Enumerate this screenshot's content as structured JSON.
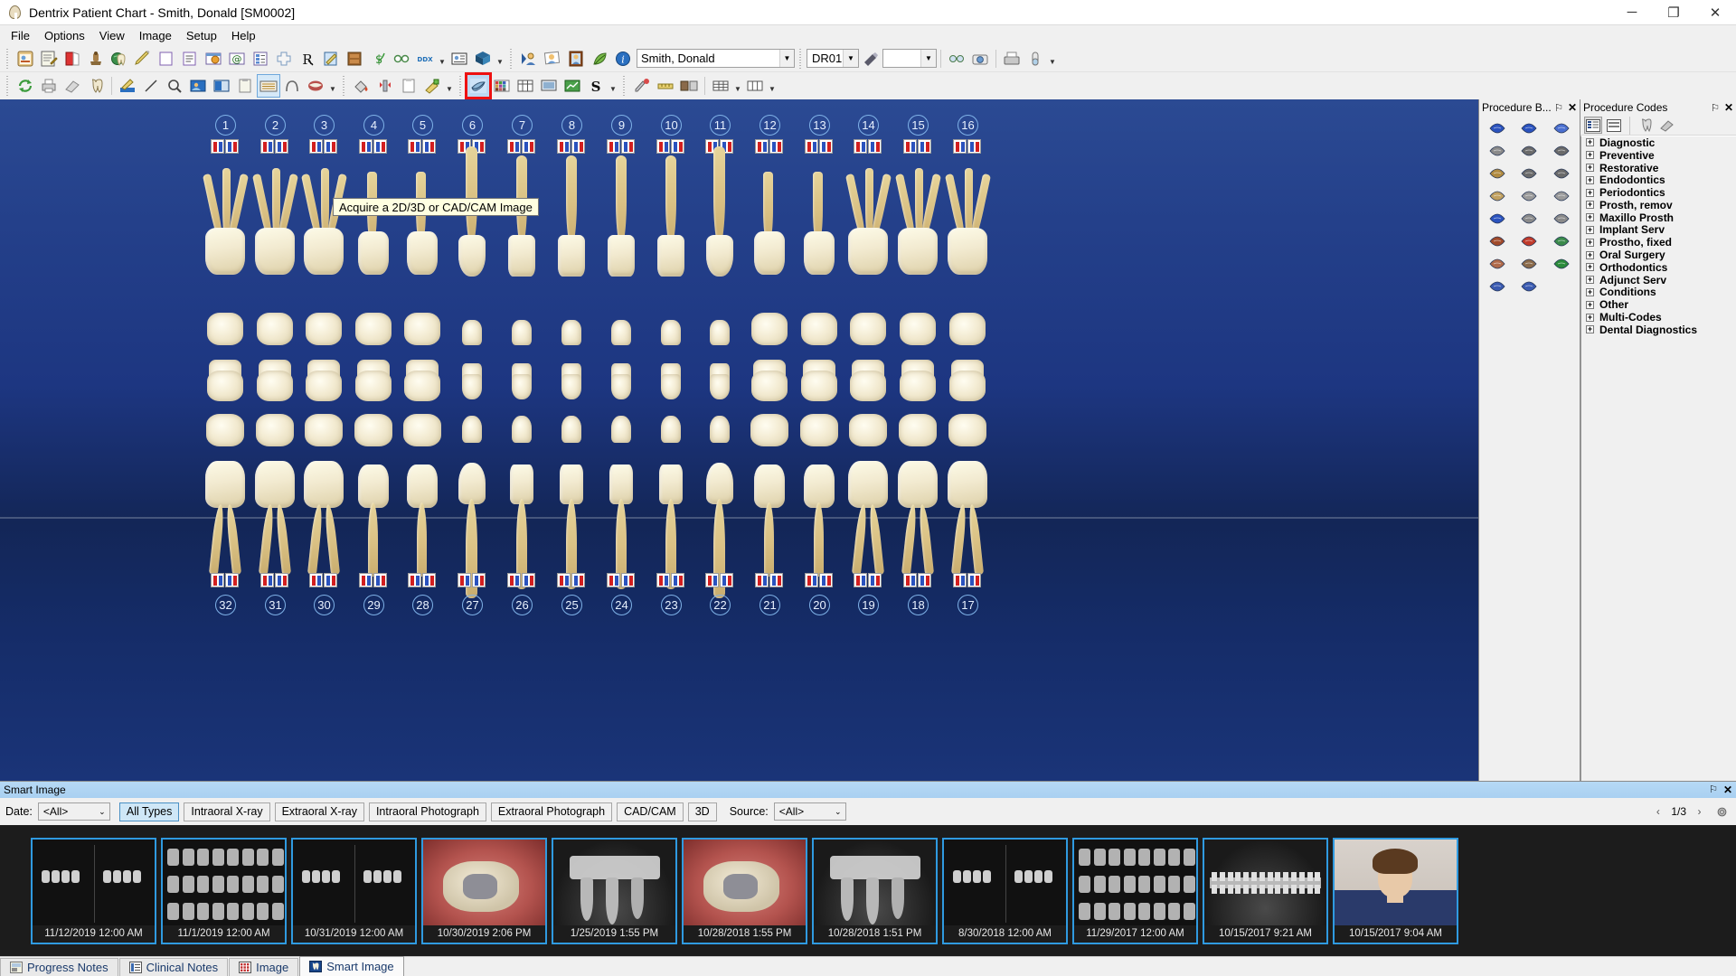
{
  "window": {
    "title": "Dentrix Patient Chart - Smith, Donald [SM0002]",
    "app_icon": "tooth-icon",
    "minimize": "─",
    "maximize": "❐",
    "close": "✕"
  },
  "menu": {
    "items": [
      {
        "label": "File"
      },
      {
        "label": "Options"
      },
      {
        "label": "View"
      },
      {
        "label": "Image"
      },
      {
        "label": "Setup"
      },
      {
        "label": "Help"
      }
    ]
  },
  "toolbar_top": {
    "buttons": [
      {
        "name": "patient-clipboard-icon"
      },
      {
        "name": "edit-notes-icon"
      },
      {
        "name": "ledger-book-icon"
      },
      {
        "name": "appointment-chair-icon"
      },
      {
        "name": "perio-globe-tooth-icon"
      },
      {
        "name": "treatment-planner-pencil-icon"
      },
      {
        "name": "blank-document-icon"
      },
      {
        "name": "document-lines-icon"
      },
      {
        "name": "office-journal-icon"
      },
      {
        "name": "email-at-icon"
      },
      {
        "name": "questionnaire-icon"
      },
      {
        "name": "medical-cross-icon"
      },
      {
        "name": "prescriptions-rx-icon"
      },
      {
        "name": "clinical-notes-icon"
      },
      {
        "name": "document-center-icon"
      },
      {
        "name": "treatment-money-icon"
      },
      {
        "name": "patient-referral-icon"
      },
      {
        "name": "ddx-icon",
        "label": "DDX"
      },
      {
        "name": "patient-card-icon"
      },
      {
        "name": "dentrix-cube-icon"
      }
    ],
    "buttons_right": [
      {
        "name": "family-file-icon"
      },
      {
        "name": "patient-picture-icon"
      },
      {
        "name": "patient-frame-icon"
      },
      {
        "name": "smart-image-leaf-icon"
      },
      {
        "name": "info-icon"
      }
    ],
    "patient_field": {
      "value": "Smith, Donald",
      "icon": "patient-avatar-icon"
    },
    "provider_combo": {
      "value": "DR01"
    },
    "ortho-icon": {
      "name": "ortho-brush-icon"
    },
    "blank_combo": {
      "value": ""
    },
    "trailing": [
      {
        "name": "glasses-icon"
      },
      {
        "name": "camera-icon"
      },
      {
        "name": "scanner-icon"
      },
      {
        "name": "pill-icon"
      }
    ]
  },
  "toolbar_second": {
    "buttons": [
      {
        "name": "refresh-green-arrows-icon"
      },
      {
        "name": "print-icon"
      },
      {
        "name": "eraser-icon"
      },
      {
        "name": "tooth-chart-icon"
      },
      {
        "name": "pencil-draw-icon"
      },
      {
        "name": "line-tool-icon"
      },
      {
        "name": "magnifier-icon"
      },
      {
        "name": "picture-blue-icon"
      },
      {
        "name": "picture-panel-icon"
      },
      {
        "name": "clipboard-small-icon"
      },
      {
        "name": "keyboard-icon"
      },
      {
        "name": "arch-icon"
      },
      {
        "name": "mouth-icon"
      }
    ],
    "group2": [
      {
        "name": "paint-bucket-icon"
      },
      {
        "name": "implant-icon"
      },
      {
        "name": "clipboard-white-icon"
      },
      {
        "name": "palette-icon"
      }
    ],
    "group3": [
      {
        "name": "acquire-image-icon",
        "highlighted": true
      },
      {
        "name": "color-grid-icon"
      },
      {
        "name": "template-icon"
      },
      {
        "name": "monitor-icon"
      },
      {
        "name": "green-chart-icon"
      },
      {
        "name": "smart-s-icon",
        "label": "S"
      }
    ],
    "group4": [
      {
        "name": "eyedropper-icon"
      },
      {
        "name": "measure-icon"
      },
      {
        "name": "compare-images-icon"
      },
      {
        "name": "grid-layout-icon"
      },
      {
        "name": "layout-columns-icon"
      }
    ]
  },
  "tooltip": {
    "text": "Acquire a 2D/3D or CAD/CAM Image"
  },
  "chart": {
    "upper_tooth_numbers": [
      "1",
      "2",
      "3",
      "4",
      "5",
      "6",
      "7",
      "8",
      "9",
      "10",
      "11",
      "12",
      "13",
      "14",
      "15",
      "16"
    ],
    "lower_tooth_numbers": [
      "32",
      "31",
      "30",
      "29",
      "28",
      "27",
      "26",
      "25",
      "24",
      "23",
      "22",
      "21",
      "20",
      "19",
      "18",
      "17"
    ]
  },
  "procedure_buttons_pane": {
    "title": "Procedure B...",
    "pin": "⚐",
    "close": "✕",
    "icons": [
      "amalgam-o-icon",
      "amalgam-mod-icon",
      "composite-hatch-icon",
      "post-core-icon",
      "crown-120-icon",
      "crown-140-icon",
      "tooth-hatch-icon",
      "crown-160-icon",
      "crown-160b-icon",
      "crown-gold-icon",
      "bridge-a-icon",
      "bridge-b-icon",
      "surface-s-icon",
      "inlay-icon",
      "onlay-icon",
      "extraction-icon",
      "endo-er-icon",
      "perio-icon",
      "denture-icon",
      "partial-icon",
      "watch-w-icon",
      "sealant-icon",
      "sealant-b-icon"
    ]
  },
  "procedure_codes_pane": {
    "title": "Procedure Codes",
    "pin": "⚐",
    "close": "✕",
    "toolbar": [
      {
        "name": "list-detail-view-icon",
        "active": true
      },
      {
        "name": "list-compact-view-icon",
        "active": false
      },
      {
        "name": "tooth-filter-icon",
        "active": false
      },
      {
        "name": "eraser-filter-icon",
        "active": false
      }
    ],
    "categories": [
      "Diagnostic",
      "Preventive",
      "Restorative",
      "Endodontics",
      "Periodontics",
      "Prosth, remov",
      "Maxillo Prosth",
      "Implant Serv",
      "Prostho, fixed",
      "Oral Surgery",
      "Orthodontics",
      "Adjunct Serv",
      "Conditions",
      "Other",
      "Multi-Codes",
      "Dental Diagnostics"
    ],
    "expand_glyph": "+"
  },
  "smart_image": {
    "panel_title": "Smart Image",
    "pin": "⚐",
    "close": "✕",
    "date_label": "Date:",
    "date_value": "<All>",
    "source_label": "Source:",
    "source_value": "<All>",
    "type_filters": [
      {
        "label": "All Types",
        "selected": true
      },
      {
        "label": "Intraoral X-ray",
        "selected": false
      },
      {
        "label": "Extraoral X-ray",
        "selected": false
      },
      {
        "label": "Intraoral Photograph",
        "selected": false
      },
      {
        "label": "Extraoral Photograph",
        "selected": false
      },
      {
        "label": "CAD/CAM",
        "selected": false
      },
      {
        "label": "3D",
        "selected": false
      }
    ],
    "prev_arrow": "‹",
    "next_arrow": "›",
    "page_indicator": "1/3",
    "settings_icon": "gear-icon",
    "thumbnails": [
      {
        "caption": "11/12/2019 12:00 AM",
        "kind": "bitewing-xray"
      },
      {
        "caption": "11/1/2019 12:00 AM",
        "kind": "fmx-series"
      },
      {
        "caption": "10/31/2019 12:00 AM",
        "kind": "bitewing-xray"
      },
      {
        "caption": "10/30/2019 2:06 PM",
        "kind": "intraoral-photo"
      },
      {
        "caption": "1/25/2019 1:55 PM",
        "kind": "periapical-xray"
      },
      {
        "caption": "10/28/2018 1:55 PM",
        "kind": "intraoral-photo"
      },
      {
        "caption": "10/28/2018 1:51 PM",
        "kind": "periapical-xray"
      },
      {
        "caption": "8/30/2018 12:00 AM",
        "kind": "bitewing-xray"
      },
      {
        "caption": "11/29/2017 12:00 AM",
        "kind": "fmx-series"
      },
      {
        "caption": "10/15/2017 9:21 AM",
        "kind": "panoramic-xray"
      },
      {
        "caption": "10/15/2017 9:04 AM",
        "kind": "portrait-photo"
      }
    ]
  },
  "bottom_tabs": [
    {
      "label": "Progress Notes",
      "icon": "progress-notes-icon",
      "active": false
    },
    {
      "label": "Clinical Notes",
      "icon": "clinical-notes-icon",
      "active": false
    },
    {
      "label": "Image",
      "icon": "image-grid-icon",
      "active": false
    },
    {
      "label": "Smart Image",
      "icon": "smart-image-tooth-icon",
      "active": true
    }
  ],
  "colors": {
    "chart_bg_top": "#2b4a93",
    "chart_bg_bottom": "#1a3478",
    "highlight_red": "#ee1111",
    "selected_blue": "#cfe7f7",
    "thumb_border": "#2f9ae0",
    "tooltip_bg": "#ffffe1"
  }
}
